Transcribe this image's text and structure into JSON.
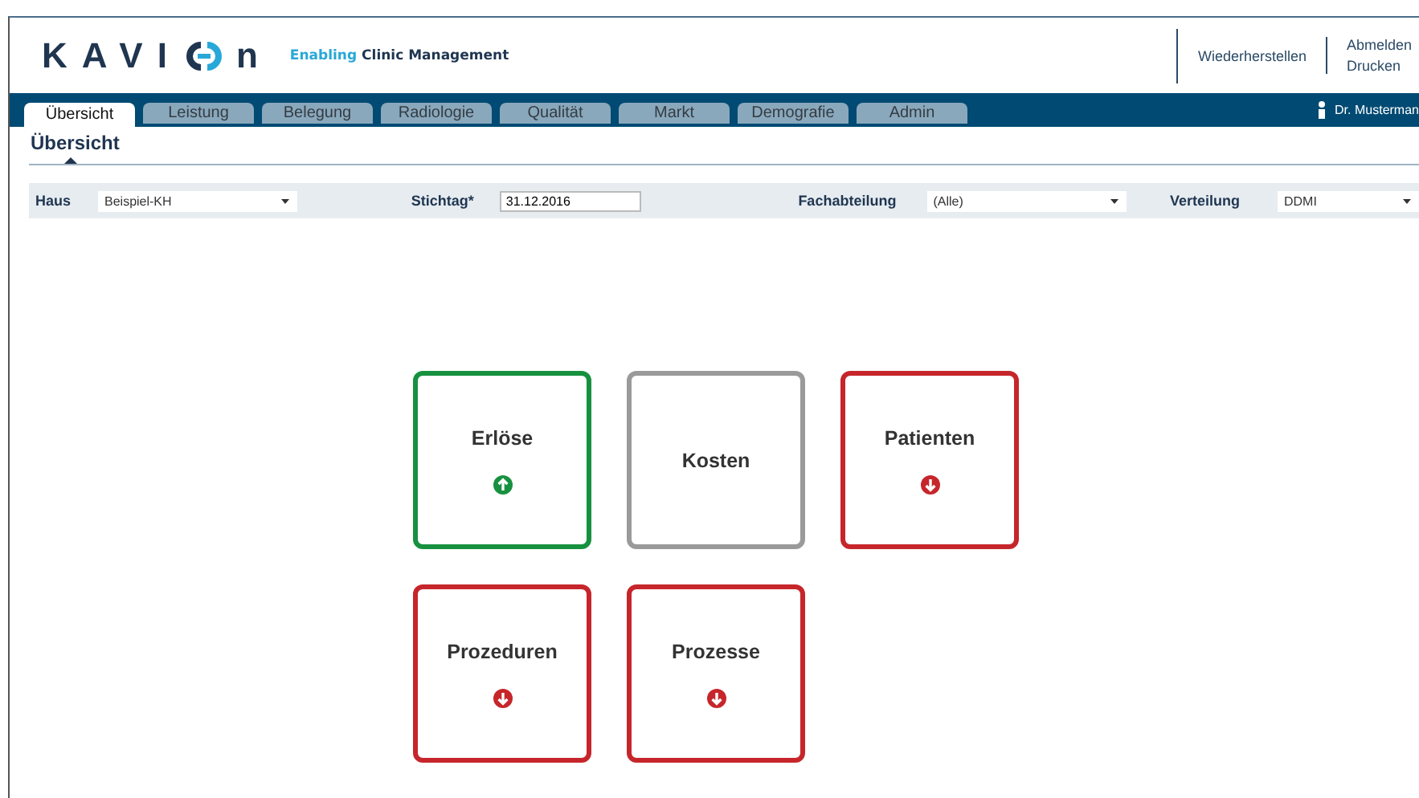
{
  "header": {
    "logo_start": "KAVI",
    "logo_end": "n",
    "tagline_accent": "Enabling",
    "tagline": "Clinic Management",
    "links": [
      "Wiederherstellen"
    ],
    "links_stacked": [
      "Abmelden",
      "Drucken"
    ]
  },
  "tabs": [
    {
      "label": "Übersicht",
      "selected": true
    },
    {
      "label": "Leistung",
      "selected": false
    },
    {
      "label": "Belegung",
      "selected": false
    },
    {
      "label": "Radiologie",
      "selected": false
    },
    {
      "label": "Qualität",
      "selected": false
    },
    {
      "label": "Markt",
      "selected": false
    },
    {
      "label": "Demografie",
      "selected": false
    },
    {
      "label": "Admin",
      "selected": false
    }
  ],
  "user": "Dr. Musterman",
  "page_title": "Übersicht",
  "filters": [
    {
      "label": "Haus",
      "kind": "select",
      "value": "Beispiel-KH"
    },
    {
      "label": "Stichtag*",
      "kind": "text",
      "value": "31.12.2016"
    },
    {
      "label": "Fachabteilung",
      "kind": "select",
      "value": "(Alle)"
    },
    {
      "label": "Verteilung",
      "kind": "select",
      "value": "DDMI"
    }
  ],
  "tiles": [
    {
      "label": "Erlöse",
      "kind": "up"
    },
    {
      "label": "Kosten",
      "kind": "neutral"
    },
    {
      "label": "Patienten",
      "kind": "down"
    },
    {
      "label": "Prozeduren",
      "kind": "down"
    },
    {
      "label": "Prozesse",
      "kind": "down"
    }
  ]
}
